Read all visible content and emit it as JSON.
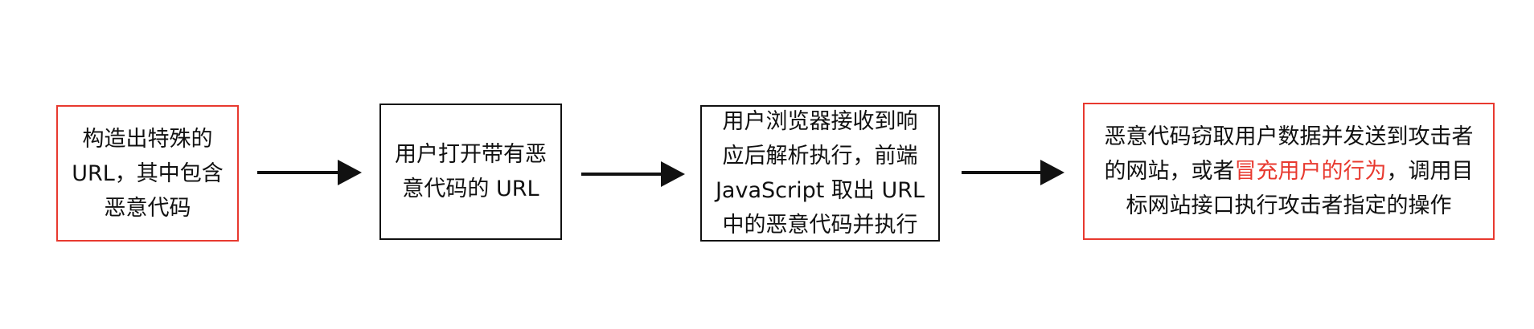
{
  "nodes": [
    {
      "lines": [
        "构造出特殊的",
        "URL，其中包含",
        "恶意代码"
      ]
    },
    {
      "lines": [
        "用户打开带有恶",
        "意代码的 URL"
      ]
    },
    {
      "lines": [
        "用户浏览器接收到响",
        "应后解析执行，前端",
        "JavaScript 取出 URL",
        "中的恶意代码并执行"
      ]
    },
    {
      "line1": "恶意代码窃取用户数据并发送到攻击者",
      "line2_before": "的网站，或者",
      "line2_highlight": "冒充用户的行为",
      "line2_after": "，调用目",
      "line3": "标网站接口执行攻击者指定的操作"
    }
  ],
  "colors": {
    "accent_red": "#e8392f",
    "stroke_black": "#111111",
    "background": "#ffffff"
  }
}
